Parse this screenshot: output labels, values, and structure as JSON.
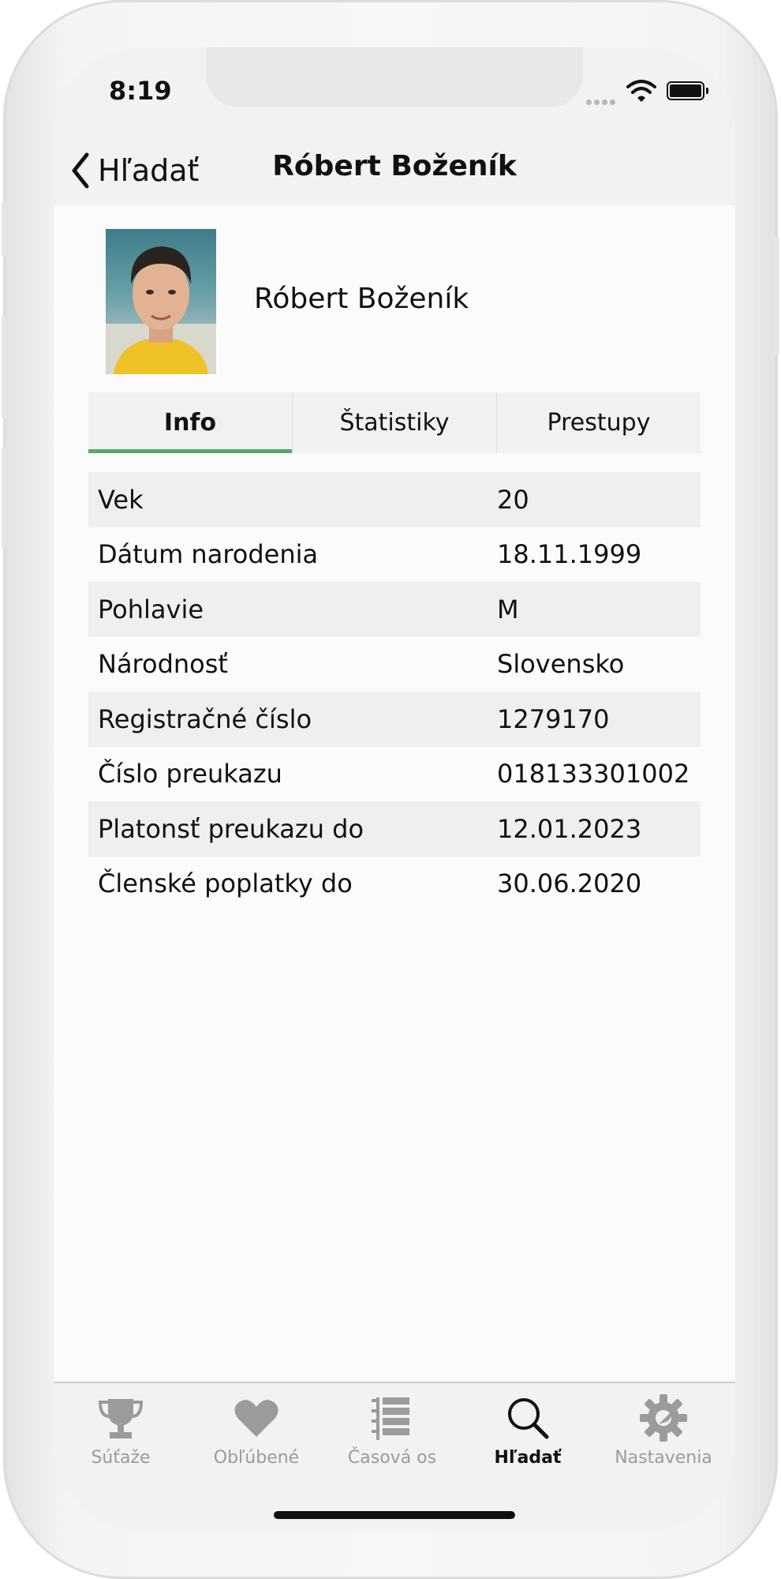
{
  "status_bar": {
    "time": "8:19"
  },
  "nav": {
    "back_label": "Hľadať",
    "title": "Róbert Boženík"
  },
  "profile": {
    "name": "Róbert Boženík"
  },
  "tabs": [
    {
      "label": "Info",
      "active": true
    },
    {
      "label": "Štatistiky",
      "active": false
    },
    {
      "label": "Prestupy",
      "active": false
    }
  ],
  "info": [
    {
      "label": "Vek",
      "value": "20"
    },
    {
      "label": "Dátum narodenia",
      "value": "18.11.1999"
    },
    {
      "label": "Pohlavie",
      "value": "M"
    },
    {
      "label": "Národnosť",
      "value": "Slovensko"
    },
    {
      "label": "Registračné číslo",
      "value": "1279170"
    },
    {
      "label": "Číslo preukazu",
      "value": "018133301002"
    },
    {
      "label": "Platonsť preukazu do",
      "value": "12.01.2023"
    },
    {
      "label": "Členské poplatky do",
      "value": "30.06.2020"
    }
  ],
  "tab_bar": [
    {
      "label": "Súťaže",
      "icon": "trophy-icon",
      "selected": false
    },
    {
      "label": "Obľúbené",
      "icon": "heart-icon",
      "selected": false
    },
    {
      "label": "Časová os",
      "icon": "timeline-icon",
      "selected": false
    },
    {
      "label": "Hľadať",
      "icon": "search-icon",
      "selected": true
    },
    {
      "label": "Nastavenia",
      "icon": "gear-icon",
      "selected": false
    }
  ],
  "colors": {
    "accent": "#5aa66d",
    "inactive_tab": "#9b9b9b",
    "row_alt": "#efefef"
  }
}
